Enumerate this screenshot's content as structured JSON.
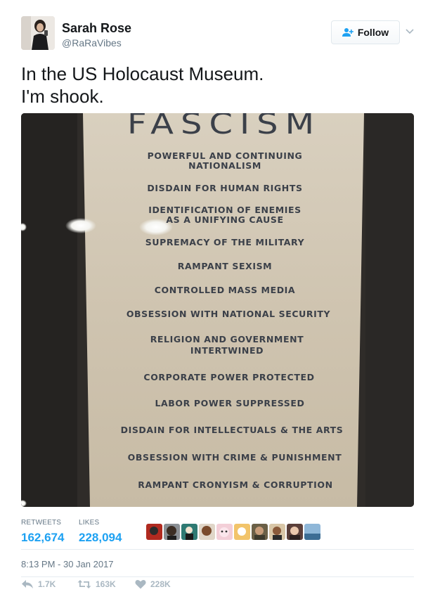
{
  "user": {
    "name": "Sarah Rose",
    "handle": "@RaRaVibes"
  },
  "follow": {
    "label": "Follow"
  },
  "tweet": {
    "lines": [
      "In the US Holocaust Museum.",
      "I'm shook."
    ]
  },
  "poster": {
    "title": "FASCISM",
    "items": [
      "POWERFUL AND CONTINUING",
      "NATIONALISM",
      "DISDAIN FOR HUMAN RIGHTS",
      "IDENTIFICATION OF ENEMIES",
      "AS A UNIFYING CAUSE",
      "SUPREMACY OF THE MILITARY",
      "RAMPANT SEXISM",
      "CONTROLLED MASS MEDIA",
      "OBSESSION WITH NATIONAL SECURITY",
      "RELIGION AND GOVERNMENT",
      "INTERTWINED",
      "CORPORATE POWER PROTECTED",
      "LABOR POWER SUPPRESSED",
      "DISDAIN FOR INTELLECTUALS & THE ARTS",
      "OBSESSION WITH CRIME & PUNISHMENT",
      "RAMPANT CRONYISM & CORRUPTION"
    ]
  },
  "stats": {
    "retweets_label": "RETWEETS",
    "retweets_value": "162,674",
    "likes_label": "LIKES",
    "likes_value": "228,094"
  },
  "timestamp": "8:13 PM - 30 Jan 2017",
  "actions": {
    "reply_count": "1.7K",
    "retweet_count": "163K",
    "like_count": "228K"
  },
  "colors": {
    "accent": "#1da1f2",
    "muted": "#657786",
    "action_gray": "#aab8c2"
  }
}
